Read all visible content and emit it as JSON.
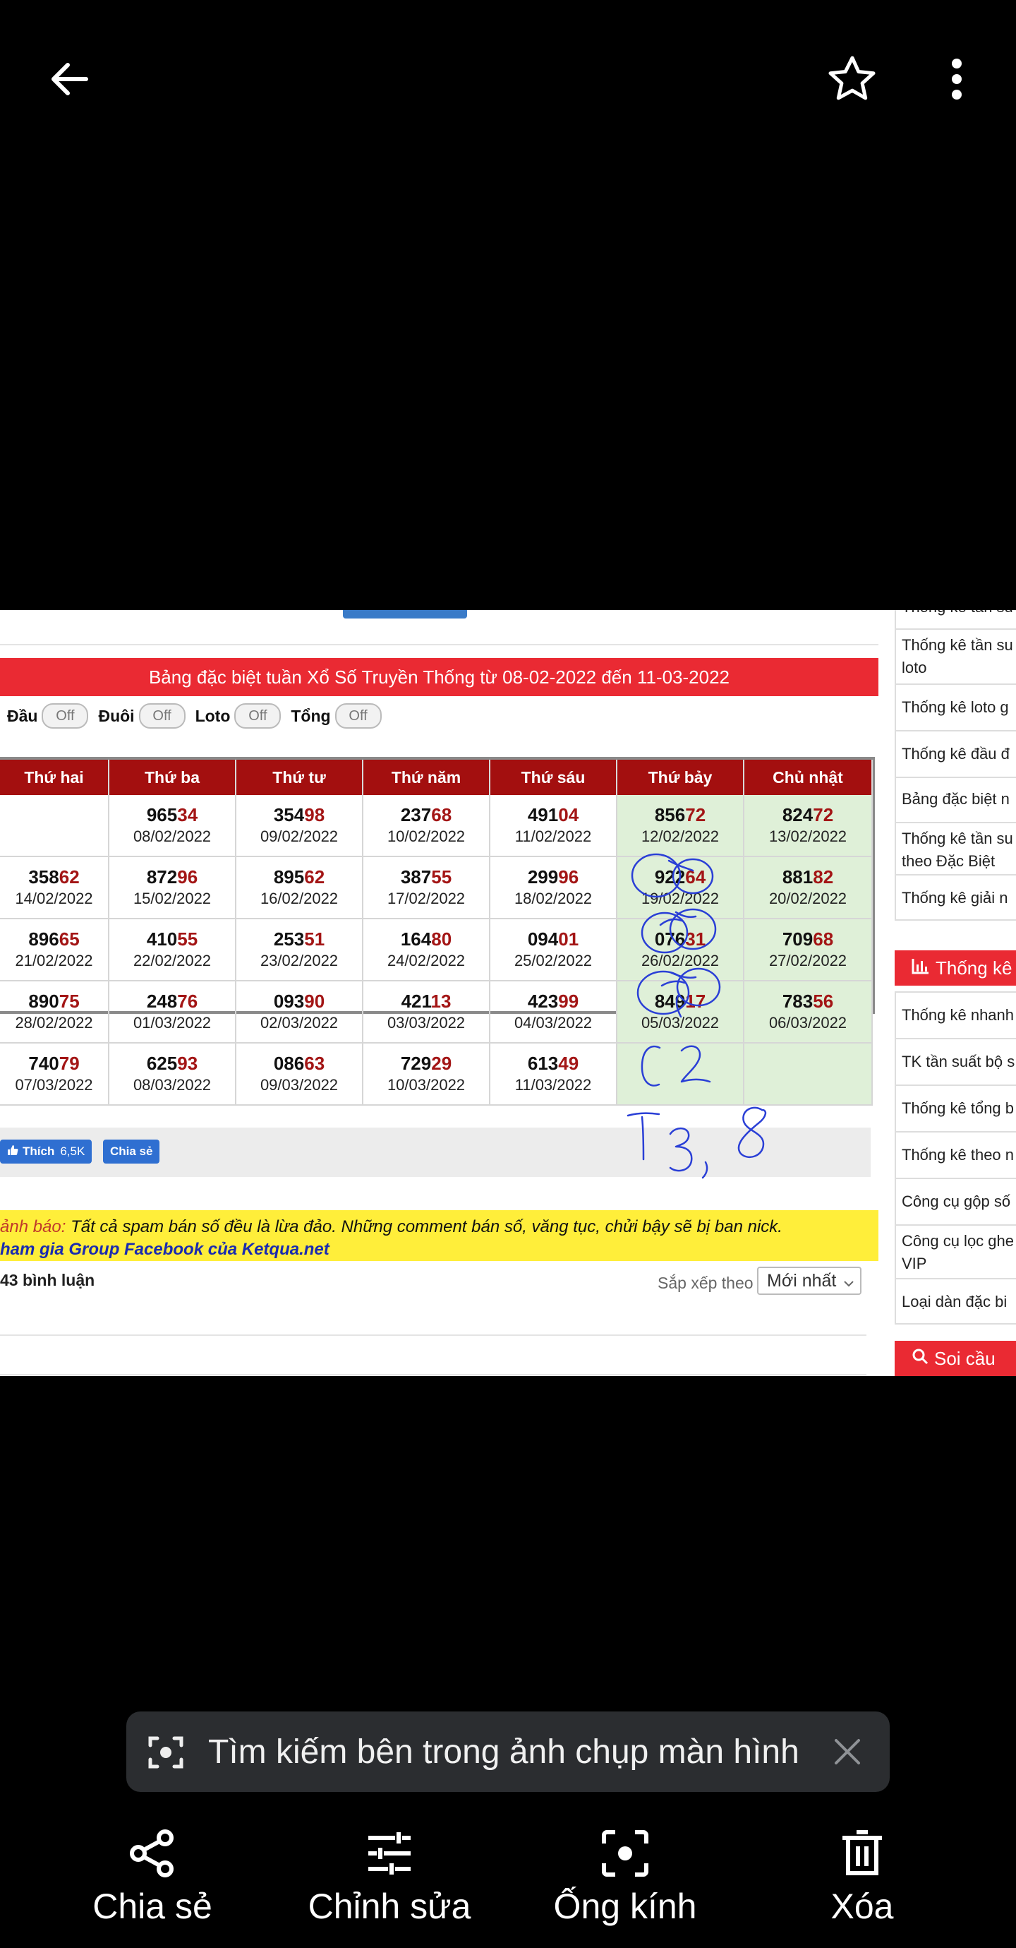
{
  "viewer": {
    "search_pill": "Tìm kiếm bên trong ảnh chụp màn hình",
    "actions": [
      {
        "label": "Chia sẻ",
        "icon": "share-icon"
      },
      {
        "label": "Chỉnh sửa",
        "icon": "sliders-icon"
      },
      {
        "label": "Ống kính",
        "icon": "lens-icon"
      },
      {
        "label": "Xóa",
        "icon": "trash-icon"
      }
    ]
  },
  "page": {
    "table_title": "Bảng đặc biệt tuần Xổ Số Truyền Thống từ 08-02-2022 đến 11-03-2022",
    "toggles": [
      {
        "label": "Đầu",
        "state": "Off"
      },
      {
        "label": "Đuôi",
        "state": "Off"
      },
      {
        "label": "Loto",
        "state": "Off"
      },
      {
        "label": "Tổng",
        "state": "Off"
      }
    ],
    "columns": [
      "Thứ hai",
      "Thứ ba",
      "Thứ tư",
      "Thứ năm",
      "Thứ sáu",
      "Thứ bảy",
      "Chủ nhật"
    ],
    "rows": [
      [
        null,
        {
          "p": "965",
          "s": "34",
          "d": "08/02/2022"
        },
        {
          "p": "354",
          "s": "98",
          "d": "09/02/2022"
        },
        {
          "p": "237",
          "s": "68",
          "d": "10/02/2022"
        },
        {
          "p": "491",
          "s": "04",
          "d": "11/02/2022"
        },
        {
          "p": "856",
          "s": "72",
          "d": "12/02/2022"
        },
        {
          "p": "824",
          "s": "72",
          "d": "13/02/2022"
        }
      ],
      [
        {
          "p": "358",
          "s": "62",
          "d": "14/02/2022"
        },
        {
          "p": "872",
          "s": "96",
          "d": "15/02/2022"
        },
        {
          "p": "895",
          "s": "62",
          "d": "16/02/2022"
        },
        {
          "p": "387",
          "s": "55",
          "d": "17/02/2022"
        },
        {
          "p": "299",
          "s": "96",
          "d": "18/02/2022"
        },
        {
          "p": "922",
          "s": "64",
          "d": "19/02/2022"
        },
        {
          "p": "881",
          "s": "82",
          "d": "20/02/2022"
        }
      ],
      [
        {
          "p": "896",
          "s": "65",
          "d": "21/02/2022"
        },
        {
          "p": "410",
          "s": "55",
          "d": "22/02/2022"
        },
        {
          "p": "253",
          "s": "51",
          "d": "23/02/2022"
        },
        {
          "p": "164",
          "s": "80",
          "d": "24/02/2022"
        },
        {
          "p": "094",
          "s": "01",
          "d": "25/02/2022"
        },
        {
          "p": "076",
          "s": "31",
          "d": "26/02/2022"
        },
        {
          "p": "709",
          "s": "68",
          "d": "27/02/2022"
        }
      ],
      [
        {
          "p": "890",
          "s": "75",
          "d": "28/02/2022"
        },
        {
          "p": "248",
          "s": "76",
          "d": "01/03/2022"
        },
        {
          "p": "093",
          "s": "90",
          "d": "02/03/2022"
        },
        {
          "p": "421",
          "s": "13",
          "d": "03/03/2022"
        },
        {
          "p": "423",
          "s": "99",
          "d": "04/03/2022"
        },
        {
          "p": "849",
          "s": "17",
          "d": "05/03/2022"
        },
        {
          "p": "783",
          "s": "56",
          "d": "06/03/2022"
        }
      ],
      [
        {
          "p": "740",
          "s": "79",
          "d": "07/03/2022"
        },
        {
          "p": "625",
          "s": "93",
          "d": "08/03/2022"
        },
        {
          "p": "086",
          "s": "63",
          "d": "09/03/2022"
        },
        {
          "p": "729",
          "s": "29",
          "d": "10/03/2022"
        },
        {
          "p": "613",
          "s": "49",
          "d": "11/03/2022"
        },
        null,
        null
      ]
    ],
    "fb_like": "Thích",
    "fb_count": "6,5K",
    "fb_share": "Chia sẻ",
    "warning_prefix": "ảnh báo:",
    "warning_text": " Tất cả spam bán số đều là lừa đảo. Những comment bán số, văng tục, chửi bậy sẽ bị ban nick.",
    "group_link": "ham gia Group Facebook của Ketqua.net",
    "comment_count": "43 bình luận",
    "sort_label": "Sắp xếp theo",
    "sort_value": "Mới nhất"
  },
  "sidebar": {
    "items_top": [
      "Thống kê tần su",
      "Thống kê tần su loto",
      "Thống kê loto g",
      "Thống kê đầu đ",
      "Bảng đặc biệt n",
      "Thống kê tần su theo Đặc Biệt",
      "Thống kê giải n"
    ],
    "section_title": "Thống kê",
    "items_bottom": [
      "Thống kê nhanh",
      "TK tần suất bộ s",
      "Thống kê tổng b",
      "Thống kê theo n",
      "Công cụ gộp số",
      "Công cụ lọc ghe VIP",
      "Loại dàn đặc bi"
    ],
    "footer_title": "Soi cầu"
  },
  "handwriting": {
    "note1": "C 2",
    "note2": "T3,8"
  },
  "colors": {
    "header_red": "#a30f0f",
    "title_red": "#ea2a33",
    "weekend_green": "#dff0d8",
    "ink_blue": "#2a3fd6"
  }
}
